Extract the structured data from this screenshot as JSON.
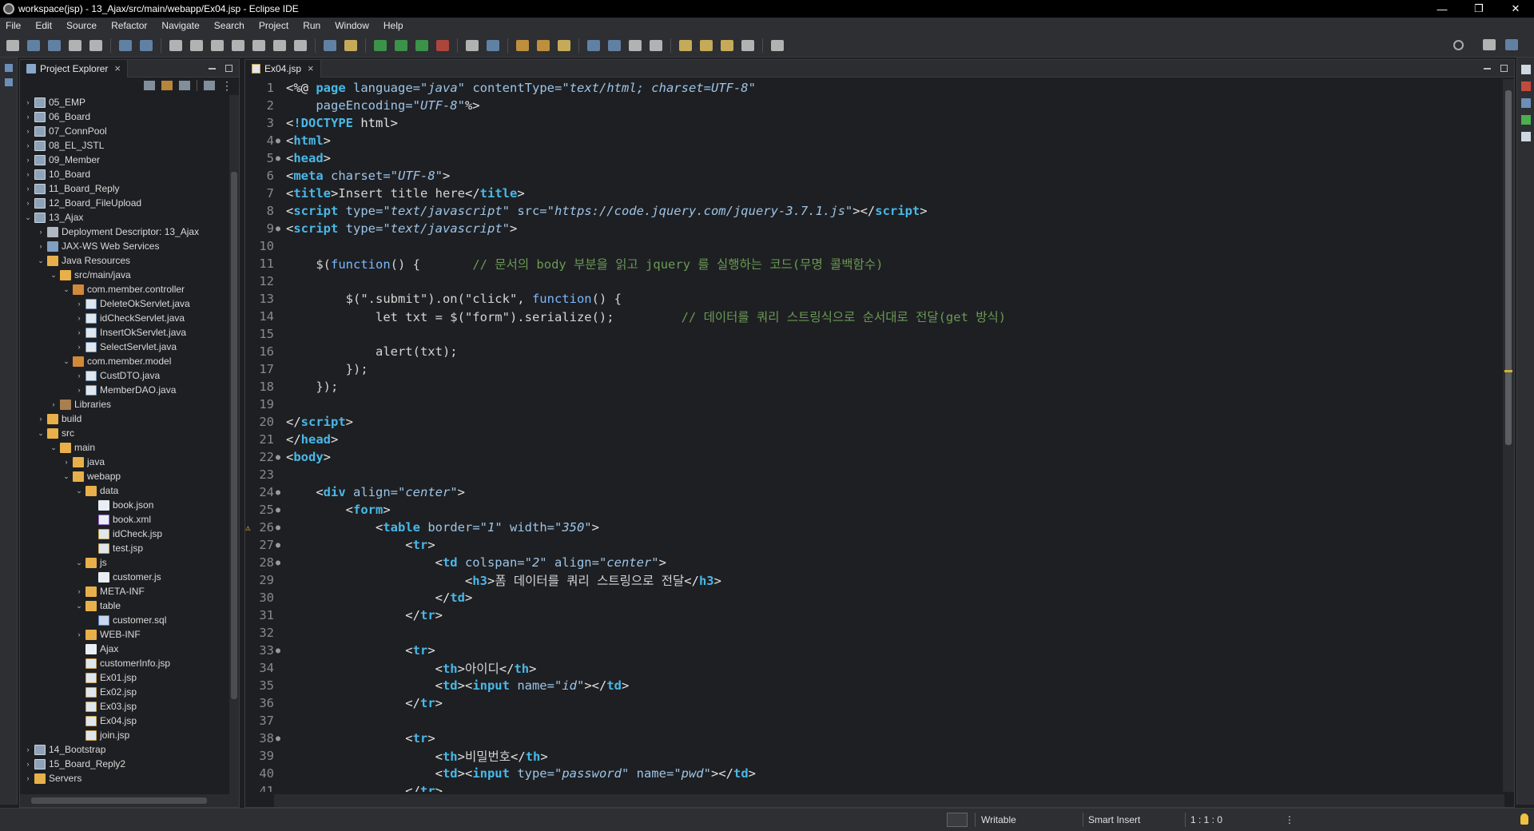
{
  "window": {
    "title": "workspace(jsp) - 13_Ajax/src/main/webapp/Ex04.jsp - Eclipse IDE",
    "minimize": "—",
    "maximize": "❐",
    "close": "✕"
  },
  "menu": [
    "File",
    "Edit",
    "Source",
    "Refactor",
    "Navigate",
    "Search",
    "Project",
    "Run",
    "Window",
    "Help"
  ],
  "explorer": {
    "tab_label": "Project Explorer",
    "tree": [
      {
        "label": "05_EMP",
        "depth": 0,
        "arrow": "›",
        "icon": "proj"
      },
      {
        "label": "06_Board",
        "depth": 0,
        "arrow": "›",
        "icon": "proj"
      },
      {
        "label": "07_ConnPool",
        "depth": 0,
        "arrow": "›",
        "icon": "proj"
      },
      {
        "label": "08_EL_JSTL",
        "depth": 0,
        "arrow": "›",
        "icon": "proj"
      },
      {
        "label": "09_Member",
        "depth": 0,
        "arrow": "›",
        "icon": "proj"
      },
      {
        "label": "10_Board",
        "depth": 0,
        "arrow": "›",
        "icon": "proj"
      },
      {
        "label": "11_Board_Reply",
        "depth": 0,
        "arrow": "›",
        "icon": "proj"
      },
      {
        "label": "12_Board_FileUpload",
        "depth": 0,
        "arrow": "›",
        "icon": "proj"
      },
      {
        "label": "13_Ajax",
        "depth": 0,
        "arrow": "⌄",
        "icon": "proj"
      },
      {
        "label": "Deployment Descriptor: 13_Ajax",
        "depth": 1,
        "arrow": "›",
        "icon": "desc"
      },
      {
        "label": "JAX-WS Web Services",
        "depth": 1,
        "arrow": "›",
        "icon": "ws"
      },
      {
        "label": "Java Resources",
        "depth": 1,
        "arrow": "⌄",
        "icon": "folder"
      },
      {
        "label": "src/main/java",
        "depth": 2,
        "arrow": "⌄",
        "icon": "folder"
      },
      {
        "label": "com.member.controller",
        "depth": 3,
        "arrow": "⌄",
        "icon": "pkg"
      },
      {
        "label": "DeleteOkServlet.java",
        "depth": 4,
        "arrow": "›",
        "icon": "java"
      },
      {
        "label": "idCheckServlet.java",
        "depth": 4,
        "arrow": "›",
        "icon": "java"
      },
      {
        "label": "InsertOkServlet.java",
        "depth": 4,
        "arrow": "›",
        "icon": "java"
      },
      {
        "label": "SelectServlet.java",
        "depth": 4,
        "arrow": "›",
        "icon": "java"
      },
      {
        "label": "com.member.model",
        "depth": 3,
        "arrow": "⌄",
        "icon": "pkg"
      },
      {
        "label": "CustDTO.java",
        "depth": 4,
        "arrow": "›",
        "icon": "java"
      },
      {
        "label": "MemberDAO.java",
        "depth": 4,
        "arrow": "›",
        "icon": "java"
      },
      {
        "label": "Libraries",
        "depth": 2,
        "arrow": "›",
        "icon": "lib"
      },
      {
        "label": "build",
        "depth": 1,
        "arrow": "›",
        "icon": "folder"
      },
      {
        "label": "src",
        "depth": 1,
        "arrow": "⌄",
        "icon": "folder"
      },
      {
        "label": "main",
        "depth": 2,
        "arrow": "⌄",
        "icon": "folder"
      },
      {
        "label": "java",
        "depth": 3,
        "arrow": "›",
        "icon": "folder"
      },
      {
        "label": "webapp",
        "depth": 3,
        "arrow": "⌄",
        "icon": "folder"
      },
      {
        "label": "data",
        "depth": 4,
        "arrow": "⌄",
        "icon": "folder"
      },
      {
        "label": "book.json",
        "depth": 5,
        "arrow": "",
        "icon": "file"
      },
      {
        "label": "book.xml",
        "depth": 5,
        "arrow": "",
        "icon": "xml"
      },
      {
        "label": "idCheck.jsp",
        "depth": 5,
        "arrow": "",
        "icon": "jsp"
      },
      {
        "label": "test.jsp",
        "depth": 5,
        "arrow": "",
        "icon": "jsp"
      },
      {
        "label": "js",
        "depth": 4,
        "arrow": "⌄",
        "icon": "folder"
      },
      {
        "label": "customer.js",
        "depth": 5,
        "arrow": "",
        "icon": "file"
      },
      {
        "label": "META-INF",
        "depth": 4,
        "arrow": "›",
        "icon": "folder"
      },
      {
        "label": "table",
        "depth": 4,
        "arrow": "⌄",
        "icon": "folder"
      },
      {
        "label": "customer.sql",
        "depth": 5,
        "arrow": "",
        "icon": "sql"
      },
      {
        "label": "WEB-INF",
        "depth": 4,
        "arrow": "›",
        "icon": "folder"
      },
      {
        "label": "Ajax",
        "depth": 4,
        "arrow": "",
        "icon": "file"
      },
      {
        "label": "customerInfo.jsp",
        "depth": 4,
        "arrow": "",
        "icon": "jsp"
      },
      {
        "label": "Ex01.jsp",
        "depth": 4,
        "arrow": "",
        "icon": "jsp"
      },
      {
        "label": "Ex02.jsp",
        "depth": 4,
        "arrow": "",
        "icon": "jsp"
      },
      {
        "label": "Ex03.jsp",
        "depth": 4,
        "arrow": "",
        "icon": "jsp"
      },
      {
        "label": "Ex04.jsp",
        "depth": 4,
        "arrow": "",
        "icon": "jsp"
      },
      {
        "label": "join.jsp",
        "depth": 4,
        "arrow": "",
        "icon": "jsp"
      },
      {
        "label": "14_Bootstrap",
        "depth": 0,
        "arrow": "›",
        "icon": "proj"
      },
      {
        "label": "15_Board_Reply2",
        "depth": 0,
        "arrow": "›",
        "icon": "proj"
      },
      {
        "label": "Servers",
        "depth": 0,
        "arrow": "›",
        "icon": "folder"
      }
    ]
  },
  "editor": {
    "tab_label": "Ex04.jsp",
    "lines": [
      {
        "n": "1",
        "fold": "",
        "segs": [
          [
            "tag",
            "<%@ "
          ],
          [
            "name",
            "page "
          ],
          [
            "attr",
            "language="
          ],
          [
            "val",
            "\"java\""
          ],
          [
            "attr",
            " contentType="
          ],
          [
            "val",
            "\"text/html; charset=UTF-8\""
          ]
        ]
      },
      {
        "n": "2",
        "fold": "",
        "segs": [
          [
            "attr",
            "    pageEncoding="
          ],
          [
            "val",
            "\"UTF-8\""
          ],
          [
            "tag",
            "%>"
          ]
        ]
      },
      {
        "n": "3",
        "fold": "",
        "segs": [
          [
            "tag",
            "<"
          ],
          [
            "name",
            "!DOCTYPE "
          ],
          [
            "tag",
            "html>"
          ]
        ]
      },
      {
        "n": "4",
        "fold": "●",
        "segs": [
          [
            "tag",
            "<"
          ],
          [
            "name",
            "html"
          ],
          [
            "tag",
            ">"
          ]
        ]
      },
      {
        "n": "5",
        "fold": "●",
        "segs": [
          [
            "tag",
            "<"
          ],
          [
            "name",
            "head"
          ],
          [
            "tag",
            ">"
          ]
        ]
      },
      {
        "n": "6",
        "fold": "",
        "segs": [
          [
            "tag",
            "<"
          ],
          [
            "name",
            "meta "
          ],
          [
            "attr",
            "charset="
          ],
          [
            "val",
            "\"UTF-8\""
          ],
          [
            "tag",
            ">"
          ]
        ]
      },
      {
        "n": "7",
        "fold": "",
        "segs": [
          [
            "tag",
            "<"
          ],
          [
            "name",
            "title"
          ],
          [
            "tag",
            ">"
          ],
          [
            "str",
            "Insert title here"
          ],
          [
            "tag",
            "</"
          ],
          [
            "name",
            "title"
          ],
          [
            "tag",
            ">"
          ]
        ]
      },
      {
        "n": "8",
        "fold": "",
        "segs": [
          [
            "tag",
            "<"
          ],
          [
            "name",
            "script "
          ],
          [
            "attr",
            "type="
          ],
          [
            "val",
            "\"text/javascript\""
          ],
          [
            "attr",
            " src="
          ],
          [
            "val",
            "\"https://code.jquery.com/jquery-3.7.1.js\""
          ],
          [
            "tag",
            "></"
          ],
          [
            "name",
            "script"
          ],
          [
            "tag",
            ">"
          ]
        ]
      },
      {
        "n": "9",
        "fold": "●",
        "segs": [
          [
            "tag",
            "<"
          ],
          [
            "name",
            "script "
          ],
          [
            "attr",
            "type="
          ],
          [
            "val",
            "\"text/javascript\""
          ],
          [
            "tag",
            ">"
          ]
        ]
      },
      {
        "n": "10",
        "fold": "",
        "segs": []
      },
      {
        "n": "11",
        "fold": "",
        "segs": [
          [
            "str",
            "    $("
          ],
          [
            "kw",
            "function"
          ],
          [
            "str",
            "() {       "
          ],
          [
            "com",
            "// 문서의 body 부분을 읽고 jquery 를 실행하는 코드(무명 콜백함수)"
          ]
        ]
      },
      {
        "n": "12",
        "fold": "",
        "segs": []
      },
      {
        "n": "13",
        "fold": "",
        "segs": [
          [
            "str",
            "        $(\".submit\").on(\"click\", "
          ],
          [
            "kw",
            "function"
          ],
          [
            "str",
            "() {"
          ]
        ]
      },
      {
        "n": "14",
        "fold": "",
        "segs": [
          [
            "str",
            "            let txt = $(\"form\").serialize();         "
          ],
          [
            "com",
            "// 데이터를 쿼리 스트링식으로 순서대로 전달(get 방식)"
          ]
        ]
      },
      {
        "n": "15",
        "fold": "",
        "segs": []
      },
      {
        "n": "16",
        "fold": "",
        "segs": [
          [
            "str",
            "            alert(txt);"
          ]
        ]
      },
      {
        "n": "17",
        "fold": "",
        "segs": [
          [
            "str",
            "        });"
          ]
        ]
      },
      {
        "n": "18",
        "fold": "",
        "segs": [
          [
            "str",
            "    });"
          ]
        ]
      },
      {
        "n": "19",
        "fold": "",
        "segs": []
      },
      {
        "n": "20",
        "fold": "",
        "segs": [
          [
            "tag",
            "</"
          ],
          [
            "name",
            "script"
          ],
          [
            "tag",
            ">"
          ]
        ]
      },
      {
        "n": "21",
        "fold": "",
        "segs": [
          [
            "tag",
            "</"
          ],
          [
            "name",
            "head"
          ],
          [
            "tag",
            ">"
          ]
        ]
      },
      {
        "n": "22",
        "fold": "●",
        "segs": [
          [
            "tag",
            "<"
          ],
          [
            "name",
            "body"
          ],
          [
            "tag",
            ">"
          ]
        ]
      },
      {
        "n": "23",
        "fold": "",
        "segs": []
      },
      {
        "n": "24",
        "fold": "●",
        "segs": [
          [
            "tag",
            "    <"
          ],
          [
            "name",
            "div "
          ],
          [
            "attr",
            "align="
          ],
          [
            "val",
            "\"center\""
          ],
          [
            "tag",
            ">"
          ]
        ]
      },
      {
        "n": "25",
        "fold": "●",
        "segs": [
          [
            "tag",
            "        <"
          ],
          [
            "name",
            "form"
          ],
          [
            "tag",
            ">"
          ]
        ]
      },
      {
        "n": "26",
        "fold": "●",
        "warn": "⚠",
        "segs": [
          [
            "tag",
            "            <"
          ],
          [
            "name",
            "table "
          ],
          [
            "attr",
            "border="
          ],
          [
            "val",
            "\"1\""
          ],
          [
            "attr",
            " width="
          ],
          [
            "val",
            "\"350\""
          ],
          [
            "tag",
            ">"
          ]
        ]
      },
      {
        "n": "27",
        "fold": "●",
        "segs": [
          [
            "tag",
            "                <"
          ],
          [
            "name",
            "tr"
          ],
          [
            "tag",
            ">"
          ]
        ]
      },
      {
        "n": "28",
        "fold": "●",
        "segs": [
          [
            "tag",
            "                    <"
          ],
          [
            "name",
            "td "
          ],
          [
            "attr",
            "colspan="
          ],
          [
            "val",
            "\"2\""
          ],
          [
            "attr",
            " align="
          ],
          [
            "val",
            "\"center\""
          ],
          [
            "tag",
            ">"
          ]
        ]
      },
      {
        "n": "29",
        "fold": "",
        "segs": [
          [
            "tag",
            "                        <"
          ],
          [
            "name",
            "h3"
          ],
          [
            "tag",
            ">"
          ],
          [
            "str",
            "폼 데이터를 쿼리 스트링으로 전달"
          ],
          [
            "tag",
            "</"
          ],
          [
            "name",
            "h3"
          ],
          [
            "tag",
            ">"
          ]
        ]
      },
      {
        "n": "30",
        "fold": "",
        "segs": [
          [
            "tag",
            "                    </"
          ],
          [
            "name",
            "td"
          ],
          [
            "tag",
            ">"
          ]
        ]
      },
      {
        "n": "31",
        "fold": "",
        "segs": [
          [
            "tag",
            "                </"
          ],
          [
            "name",
            "tr"
          ],
          [
            "tag",
            ">"
          ]
        ]
      },
      {
        "n": "32",
        "fold": "",
        "segs": []
      },
      {
        "n": "33",
        "fold": "●",
        "segs": [
          [
            "tag",
            "                <"
          ],
          [
            "name",
            "tr"
          ],
          [
            "tag",
            ">"
          ]
        ]
      },
      {
        "n": "34",
        "fold": "",
        "segs": [
          [
            "tag",
            "                    <"
          ],
          [
            "name",
            "th"
          ],
          [
            "tag",
            ">"
          ],
          [
            "str",
            "아이디"
          ],
          [
            "tag",
            "</"
          ],
          [
            "name",
            "th"
          ],
          [
            "tag",
            ">"
          ]
        ]
      },
      {
        "n": "35",
        "fold": "",
        "segs": [
          [
            "tag",
            "                    <"
          ],
          [
            "name",
            "td"
          ],
          [
            "tag",
            "><"
          ],
          [
            "name",
            "input "
          ],
          [
            "attr",
            "name="
          ],
          [
            "val",
            "\"id\""
          ],
          [
            "tag",
            "></"
          ],
          [
            "name",
            "td"
          ],
          [
            "tag",
            ">"
          ]
        ]
      },
      {
        "n": "36",
        "fold": "",
        "segs": [
          [
            "tag",
            "                </"
          ],
          [
            "name",
            "tr"
          ],
          [
            "tag",
            ">"
          ]
        ]
      },
      {
        "n": "37",
        "fold": "",
        "segs": []
      },
      {
        "n": "38",
        "fold": "●",
        "segs": [
          [
            "tag",
            "                <"
          ],
          [
            "name",
            "tr"
          ],
          [
            "tag",
            ">"
          ]
        ]
      },
      {
        "n": "39",
        "fold": "",
        "segs": [
          [
            "tag",
            "                    <"
          ],
          [
            "name",
            "th"
          ],
          [
            "tag",
            ">"
          ],
          [
            "str",
            "비밀번호"
          ],
          [
            "tag",
            "</"
          ],
          [
            "name",
            "th"
          ],
          [
            "tag",
            ">"
          ]
        ]
      },
      {
        "n": "40",
        "fold": "",
        "segs": [
          [
            "tag",
            "                    <"
          ],
          [
            "name",
            "td"
          ],
          [
            "tag",
            "><"
          ],
          [
            "name",
            "input "
          ],
          [
            "attr",
            "type="
          ],
          [
            "val",
            "\"password\""
          ],
          [
            "attr",
            " name="
          ],
          [
            "val",
            "\"pwd\""
          ],
          [
            "tag",
            "></"
          ],
          [
            "name",
            "td"
          ],
          [
            "tag",
            ">"
          ]
        ]
      },
      {
        "n": "41",
        "fold": "",
        "segs": [
          [
            "tag",
            "                </"
          ],
          [
            "name",
            "tr"
          ],
          [
            "tag",
            ">"
          ]
        ]
      }
    ]
  },
  "status": {
    "mode": "Writable",
    "insert": "Smart Insert",
    "position": "1 : 1 : 0",
    "more": "⋮"
  },
  "colors": {
    "background": "#1e1f22",
    "chrome": "#2d2f33",
    "tag_name": "#48b8e8",
    "comment": "#6a9955"
  }
}
